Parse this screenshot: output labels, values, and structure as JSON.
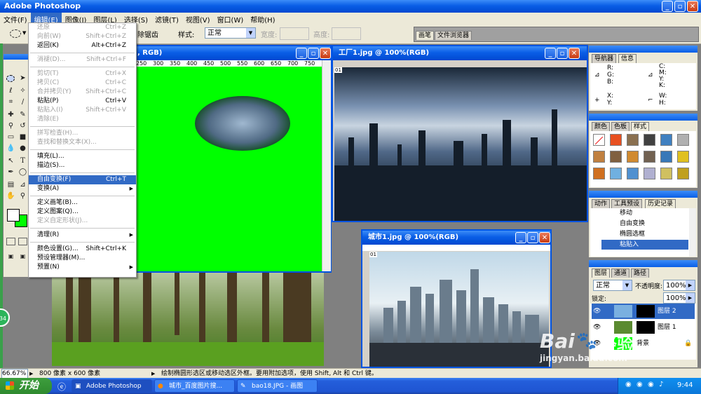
{
  "app": {
    "title": "Adobe Photoshop"
  },
  "menubar": {
    "items": [
      "文件(F)",
      "编辑(E)",
      "图像(I)",
      "图层(L)",
      "选择(S)",
      "滤镜(T)",
      "视图(V)",
      "窗口(W)",
      "帮助(H)"
    ]
  },
  "options": {
    "feather_label": "除锯齿",
    "style_label": "样式:",
    "style_value": "正常",
    "width_label": "宽度:",
    "height_label": "高度:",
    "tab_brushes": "画笔",
    "tab_browser": "文件浏览器"
  },
  "edit_menu": {
    "items": [
      {
        "label": "还原",
        "shortcut": "Ctrl+Z",
        "disabled": true
      },
      {
        "label": "向前(W)",
        "shortcut": "Shift+Ctrl+Z",
        "disabled": true
      },
      {
        "label": "返回(K)",
        "shortcut": "Alt+Ctrl+Z",
        "disabled": false
      },
      {
        "sep": true
      },
      {
        "label": "消褪(D)...",
        "shortcut": "Shift+Ctrl+F",
        "disabled": true
      },
      {
        "sep": true
      },
      {
        "label": "剪切(T)",
        "shortcut": "Ctrl+X",
        "disabled": true
      },
      {
        "label": "拷贝(C)",
        "shortcut": "Ctrl+C",
        "disabled": true
      },
      {
        "label": "合并拷贝(Y)",
        "shortcut": "Shift+Ctrl+C",
        "disabled": true
      },
      {
        "label": "粘贴(P)",
        "shortcut": "Ctrl+V",
        "disabled": false
      },
      {
        "label": "粘贴入(I)",
        "shortcut": "Shift+Ctrl+V",
        "disabled": true
      },
      {
        "label": "清除(E)",
        "shortcut": "",
        "disabled": true
      },
      {
        "sep": true
      },
      {
        "label": "拼写检查(H)...",
        "shortcut": "",
        "disabled": true
      },
      {
        "label": "查找和替换文本(X)...",
        "shortcut": "",
        "disabled": true
      },
      {
        "sep": true
      },
      {
        "label": "填充(L)...",
        "shortcut": "",
        "disabled": false
      },
      {
        "label": "描边(S)...",
        "shortcut": "",
        "disabled": false
      },
      {
        "sep": true
      },
      {
        "label": "自由变换(F)",
        "shortcut": "Ctrl+T",
        "disabled": false,
        "selected": true
      },
      {
        "label": "变换(A)",
        "shortcut": "",
        "disabled": false,
        "submenu": true
      },
      {
        "sep": true
      },
      {
        "label": "定义画笔(B)...",
        "shortcut": "",
        "disabled": false
      },
      {
        "label": "定义图案(Q)...",
        "shortcut": "",
        "disabled": false
      },
      {
        "label": "定义自定形状(J)...",
        "shortcut": "",
        "disabled": true
      },
      {
        "sep": true
      },
      {
        "label": "清理(R)",
        "shortcut": "",
        "disabled": false,
        "submenu": true
      },
      {
        "sep": true
      },
      {
        "label": "颜色设置(G)...",
        "shortcut": "Shift+Ctrl+K",
        "disabled": false
      },
      {
        "label": "预设管理器(M)...",
        "shortcut": "",
        "disabled": false
      },
      {
        "label": "预置(N)",
        "shortcut": "",
        "disabled": false,
        "submenu": true
      }
    ]
  },
  "doc1": {
    "title": ", RGB)",
    "ruler": [
      "250",
      "300",
      "350",
      "400",
      "450",
      "500",
      "550",
      "600",
      "650",
      "700",
      "750"
    ]
  },
  "doc2": {
    "title": "工厂1.jpg @ 100%(RGB)",
    "marker": "01"
  },
  "doc3": {
    "title": "城市1.jpg @ 100%(RGB)",
    "marker": "01"
  },
  "navigator": {
    "tab_nav": "导航器",
    "tab_info": "信息",
    "rgb": [
      "R:",
      "G:",
      "B:"
    ],
    "cmyk": [
      "C:",
      "M:",
      "Y:",
      "K:"
    ],
    "xy": [
      "X:",
      "Y:"
    ],
    "wh": [
      "W:",
      "H:"
    ]
  },
  "swatches": {
    "tabs": [
      "颜色",
      "色板",
      "样式"
    ],
    "colors": [
      "#ffffff",
      "#e85020",
      "#8a7050",
      "#404040",
      "#4080c0",
      "#b0b0b0",
      "#c08040",
      "#806040",
      "#d08a30",
      "#706050",
      "#3878b8",
      "#e0c020",
      "#d07020",
      "#70b0e0",
      "#5090d0",
      "#b0b0d0",
      "#d0c060",
      "#c0a020"
    ]
  },
  "history": {
    "tabs": [
      "动作",
      "工具预设",
      "历史记录"
    ],
    "items": [
      "移动",
      "自由变换",
      "椭圆选框",
      "粘贴入"
    ]
  },
  "layers": {
    "tabs": [
      "图层",
      "通道",
      "路径"
    ],
    "blend_mode": "正常",
    "opacity_label": "不透明度:",
    "opacity_value": "100%",
    "lock_label": "锁定:",
    "fill_value": "100%",
    "items": [
      "图层 2",
      "图层 1",
      "背景"
    ]
  },
  "status": {
    "zoom": "66.67%",
    "doc_size": "800 像素 x 600 像素",
    "hint": "绘制椭圆形选区或移动选区外框。要用附加选项，使用 Shift, Alt 和 Ctrl 键。"
  },
  "taskbar": {
    "start": "开始",
    "buttons": [
      "Adobe Photoshop",
      "城市_百度图片搜...",
      "bao18.JPG - 画图"
    ],
    "clock": "9:44"
  },
  "watermark": {
    "brand": "Bai",
    "brand2": "经验",
    "url": "jingyan.baidu.com"
  },
  "circle_badge": "34"
}
